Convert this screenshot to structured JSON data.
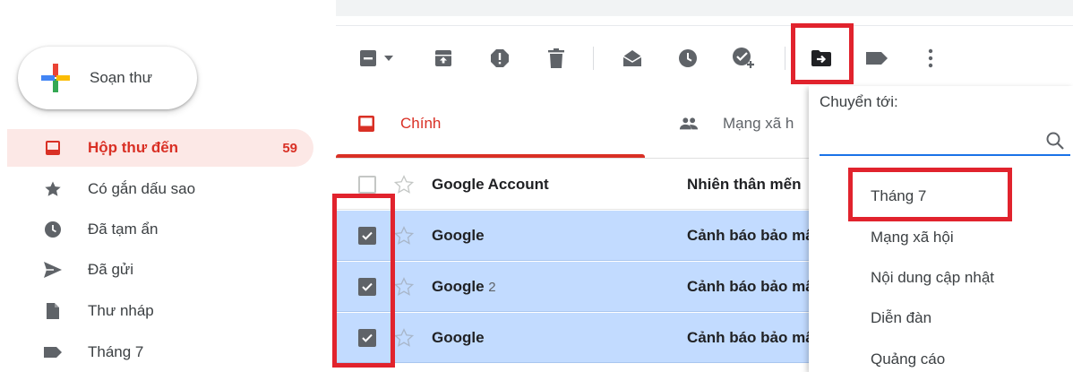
{
  "compose": {
    "label": "Soạn thư"
  },
  "sidebar": {
    "items": [
      {
        "label": "Hộp thư đến",
        "count": "59",
        "icon": "inbox-icon"
      },
      {
        "label": "Có gắn dấu sao",
        "icon": "star-icon"
      },
      {
        "label": "Đã tạm ẩn",
        "icon": "clock-icon"
      },
      {
        "label": "Đã gửi",
        "icon": "send-icon"
      },
      {
        "label": "Thư nháp",
        "icon": "draft-icon"
      },
      {
        "label": "Tháng 7",
        "icon": "label-icon"
      }
    ]
  },
  "toolbar": {
    "icons": [
      "select-checkbox-icon",
      "dropdown-arrow-icon",
      "archive-icon",
      "report-spam-icon",
      "delete-icon",
      "mark-as-read-icon",
      "snooze-icon",
      "add-to-tasks-icon",
      "move-to-icon",
      "label-icon",
      "more-icon"
    ]
  },
  "tabs": [
    {
      "label": "Chính",
      "icon": "inbox-icon"
    },
    {
      "label": "Mạng xã h",
      "icon": "people-icon"
    }
  ],
  "emails": [
    {
      "sender": "Google Account",
      "count": "",
      "subject": "Nhiên thân mến",
      "selected": false
    },
    {
      "sender": "Google",
      "count": "",
      "subject": "Cảnh báo bảo mật",
      "selected": true
    },
    {
      "sender": "Google",
      "count": "2",
      "subject": "Cảnh báo bảo mật",
      "selected": true
    },
    {
      "sender": "Google",
      "count": "",
      "subject": "Cảnh báo bảo mật",
      "selected": true
    }
  ],
  "move_menu": {
    "title": "Chuyển tới:",
    "search_value": "",
    "options": [
      "Tháng 7",
      "Mạng xã hội",
      "Nội dung cập nhật",
      "Diễn đàn",
      "Quảng cáo"
    ]
  },
  "colors": {
    "accent_red": "#d93025",
    "highlight_red": "#e1232d",
    "selected_row": "#c2dbff",
    "link_blue": "#1a73e8"
  }
}
